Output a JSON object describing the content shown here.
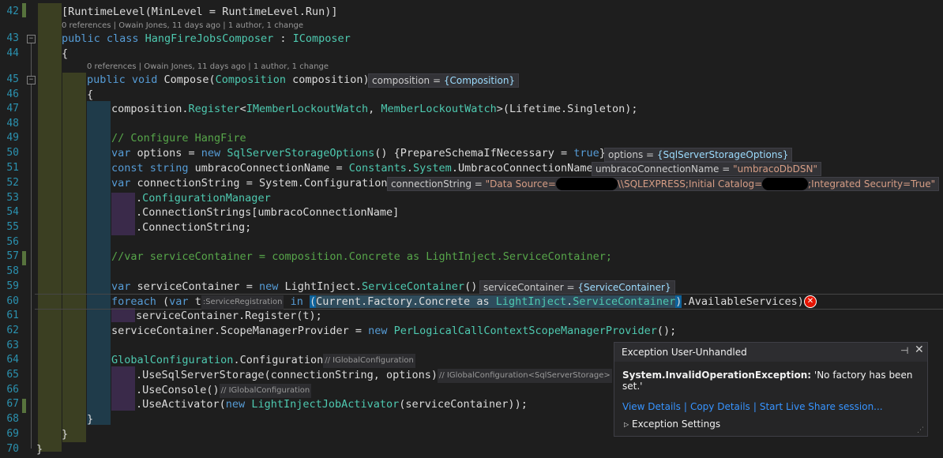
{
  "line_numbers": [
    "42",
    "43",
    "44",
    "45",
    "46",
    "47",
    "48",
    "49",
    "50",
    "51",
    "52",
    "53",
    "54",
    "55",
    "56",
    "57",
    "58",
    "59",
    "60",
    "61",
    "62",
    "63",
    "64",
    "65",
    "66",
    "67",
    "68",
    "69",
    "70"
  ],
  "codelens": {
    "class": "0 references | Owain Jones, 11 days ago | 1 author, 1 change",
    "method": "0 references | Owain Jones, 11 days ago | 1 author, 1 change"
  },
  "code": {
    "l42": "[RuntimeLevel(MinLevel = RuntimeLevel.Run)]",
    "l43_a": "public class ",
    "l43_b": "HangFireJobsComposer",
    "l43_c": " : ",
    "l43_d": "IComposer",
    "l44": "{",
    "l45_a": "public void ",
    "l45_b": "Compose(",
    "l45_c": "Composition",
    "l45_d": " composition)",
    "l46": "{",
    "l47_a": "composition.",
    "l47_b": "Register",
    "l47_c": "<",
    "l47_d": "IMemberLockoutWatch",
    "l47_e": ", ",
    "l47_f": "MemberLockoutWatch",
    "l47_g": ">(Lifetime.Singleton);",
    "l49": "// Configure HangFire",
    "l50_a": "var",
    "l50_b": " options = ",
    "l50_c": "new",
    "l50_d": " ",
    "l50_e": "SqlServerStorageOptions",
    "l50_f": "() {PrepareSchemaIfNecessary = ",
    "l50_g": "true",
    "l50_h": "};",
    "l51_a": "const string",
    "l51_b": " umbracoConnectionName = ",
    "l51_c": "Constants",
    "l51_d": ".",
    "l51_e": "System",
    "l51_f": ".UmbracoConnectionName;",
    "l52_a": "var",
    "l52_b": " connectionString = System.Configuration",
    "l53_a": ".",
    "l53_b": "ConfigurationManager",
    "l54": ".ConnectionStrings[umbracoConnectionName]",
    "l55": ".ConnectionString;",
    "l57": "//var serviceContainer = composition.Concrete as LightInject.ServiceContainer;",
    "l59_a": "var",
    "l59_b": " serviceContainer = ",
    "l59_c": "new",
    "l59_d": " LightInject.",
    "l59_e": "ServiceContainer",
    "l59_f": "();",
    "l60_a": "foreach",
    "l60_b": " (",
    "l60_c": "var",
    "l60_d": " t",
    "l60_hint": ":ServiceRegistration",
    "l60_e": " in ",
    "l60_f": "(",
    "l60_g": "Current.Factory.Concrete as ",
    "l60_h": "LightInject",
    "l60_i": ".",
    "l60_j": "ServiceContainer",
    "l60_k": ")",
    "l60_l": ".AvailableServices)",
    "l61": "serviceContainer.Register(t);",
    "l62_a": "serviceContainer.ScopeManagerProvider = ",
    "l62_b": "new",
    "l62_c": " ",
    "l62_d": "PerLogicalCallContextScopeManagerProvider",
    "l62_e": "();",
    "l64_a": "GlobalConfiguration",
    "l64_b": ".Configuration",
    "l64_hint": "// IGlobalConfiguration",
    "l65_a": ".UseSqlServerStorage(connectionString, options)",
    "l65_hint": "// IGlobalConfiguration<SqlServerStorage>",
    "l66_a": ".UseConsole()",
    "l66_hint": "// IGlobalConfiguration",
    "l67_a": ".UseActivator(",
    "l67_b": "new",
    "l67_c": " ",
    "l67_d": "LightInjectJobActivator",
    "l67_e": "(serviceContainer));",
    "l68": "}",
    "l69": "}",
    "l70": "}"
  },
  "datatips": {
    "composition_name": "composition = ",
    "composition_val": "{Composition}",
    "options_name": "options = ",
    "options_val": "{SqlServerStorageOptions}",
    "ucn_name": "umbracoConnectionName = ",
    "ucn_val": "\"umbracoDbDSN\"",
    "cs_name": "connectionString = ",
    "cs_val_a": "\"Data Source=",
    "cs_val_b": "\\\\SQLEXPRESS;Initial Catalog=",
    "cs_val_c": ";Integrated Security=True\"",
    "sc_name": "serviceContainer = ",
    "sc_val": "{ServiceContainer}"
  },
  "exception_popup": {
    "title": "Exception User-Unhandled",
    "pin_icon": "pin-icon",
    "close_icon": "close-icon",
    "type": "System.InvalidOperationException:",
    "message": " 'No factory has been set.'",
    "link_view": "View Details",
    "link_copy": "Copy Details",
    "link_share": "Start Live Share session...",
    "separator": "|",
    "settings_label": "Exception Settings"
  },
  "colors": {
    "background": "#1e1e1e",
    "keyword": "#569cd6",
    "type": "#4ec9b0",
    "comment": "#57a64a",
    "line_number": "#2b91af",
    "error": "#e51400"
  }
}
